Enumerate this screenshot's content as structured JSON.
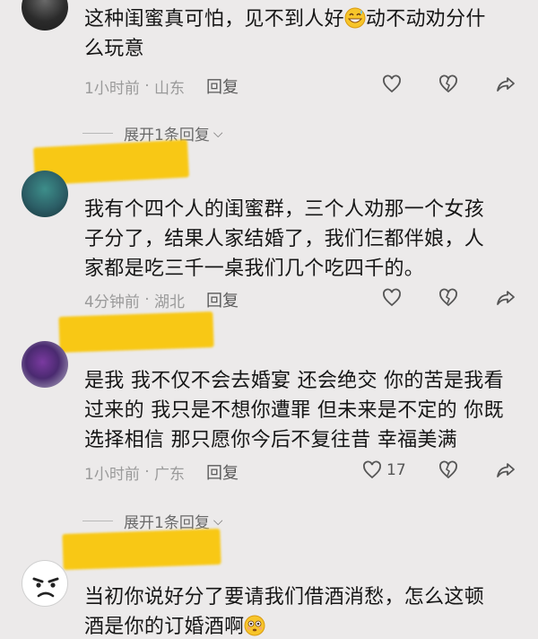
{
  "comments": [
    {
      "text": "这种闺蜜真可怕，见不到人好😅动不动劝分什么玩意",
      "line1": "这种闺蜜真可怕，见不到人好",
      "line1b": "动不动劝分什",
      "line2": "么玩意",
      "time": "1小时前",
      "location": "山东",
      "reply": "回复",
      "likes": ""
    },
    {
      "line1": "我有个四个人的闺蜜群，三个人劝那一个女孩",
      "line2": "子分了，结果人家结婚了，我们仨都伴娘，人",
      "line3": "家都是吃三千一桌我们几个吃四千的。",
      "time": "4分钟前",
      "location": "湖北",
      "reply": "回复",
      "likes": ""
    },
    {
      "line1": "是我 我不仅不会去婚宴 还会绝交 你的苦是我看",
      "line2": "过来的 我只是不想你遭罪 但未来是不定的 你既",
      "line3": "选择相信 那只愿你今后不复往昔 幸福美满",
      "time": "1小时前",
      "location": "广东",
      "reply": "回复",
      "likes": "17"
    },
    {
      "line1": "当初你说好分了要请我们借酒消愁，怎么这顿",
      "line2": "酒是你的订婚酒啊",
      "line2_emoji": "😳"
    }
  ],
  "expand_label": "展开1条回复",
  "icons": {
    "like": "heart-icon",
    "dislike": "broken-heart-icon",
    "share": "share-arrow-icon",
    "expand": "chevron-down-icon"
  },
  "colors": {
    "background": "#eceaea",
    "redaction": "#f8c815",
    "meta_text": "#9a9a9a"
  }
}
